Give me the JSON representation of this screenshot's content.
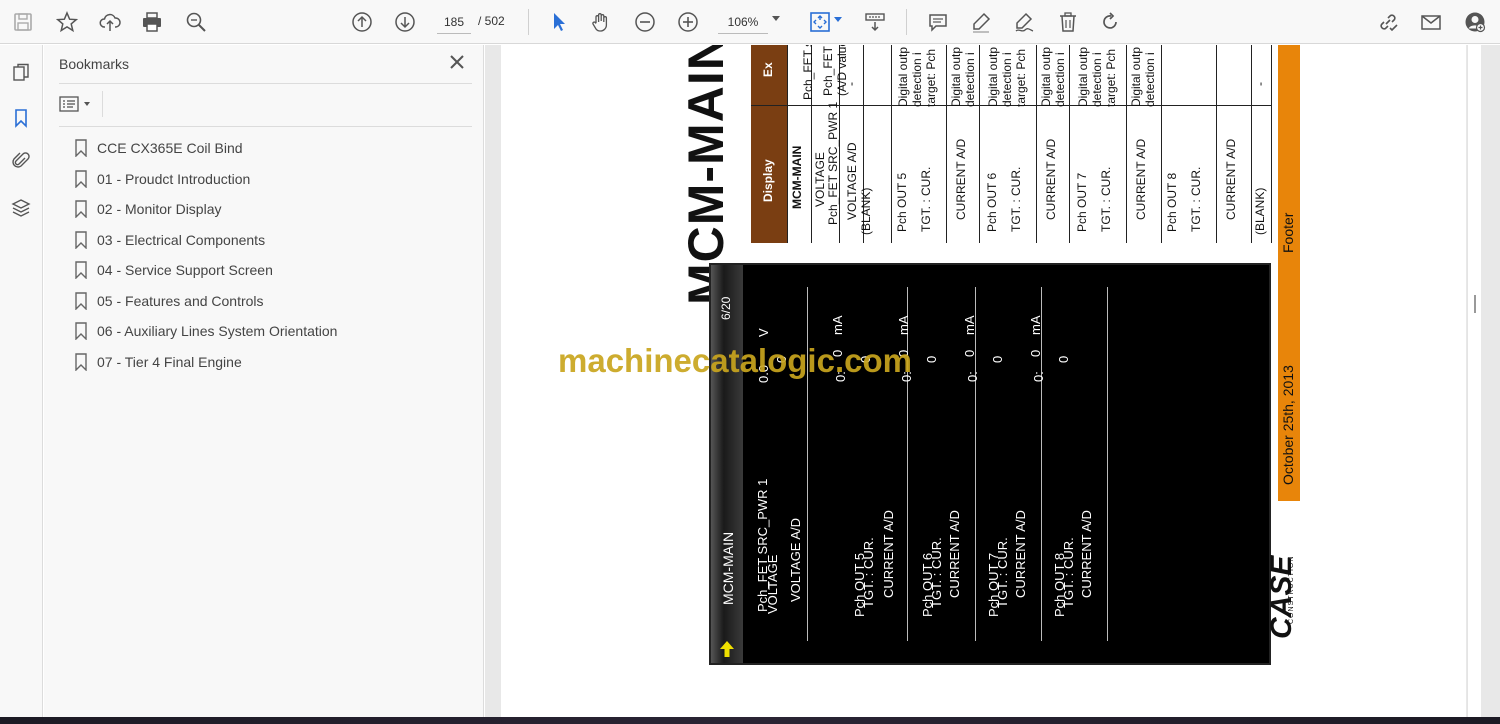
{
  "toolbar": {
    "current_page": "185",
    "page_total": "/ 502",
    "zoom": "106%"
  },
  "bookmarks": {
    "title": "Bookmarks",
    "items": [
      {
        "label": "CCE CX365E Coil Bind"
      },
      {
        "label": "01 - Proudct Introduction"
      },
      {
        "label": "02 - Monitor Display"
      },
      {
        "label": "03 - Electrical Components"
      },
      {
        "label": "04 - Service Support Screen"
      },
      {
        "label": "05 - Features and Controls"
      },
      {
        "label": "06 - Auxiliary Lines System Orientation"
      },
      {
        "label": "07 - Tier 4 Final Engine"
      }
    ]
  },
  "document": {
    "heading": "MCM-MAIN",
    "table_header": {
      "col1": "Display",
      "col2": "Ex"
    },
    "table_display_col": [
      "MCM-MAIN",
      "Pch_FET SRC_PWR 1",
      "VOLTAGE",
      "VOLTAGE A/D",
      "(BLANK)",
      "Pch OUT 5",
      "TGT. : CUR.",
      "CURRENT A/D",
      "Pch OUT 6",
      "TGT. : CUR.",
      "CURRENT A/D",
      "Pch OUT 7",
      "TGT. : CUR.",
      "CURRENT A/D",
      "Pch OUT 8",
      "TGT. : CUR.",
      "CURRENT A/D",
      "(BLANK)"
    ],
    "table_expl_col": [
      "-",
      "Pch_FET s",
      "Pch_FET s",
      "(A/D value",
      "-",
      "Digital outp",
      "detection i",
      "target: Pch",
      "Digital outp",
      "detection i",
      "Digital outp",
      "detection i",
      "target: Pch",
      "Digital outp",
      "detection i",
      "Digital outp",
      "detection i",
      "target: Pch",
      "Digital outp",
      "detection i",
      "-"
    ],
    "monitor": {
      "title": "MCM-MAIN",
      "page": "6/20",
      "rows": [
        {
          "label1": "Pch_FET SRC_PWR 1",
          "label2": "VOLTAGE",
          "value": "0.0",
          "unit": "V"
        },
        {
          "label1": "VOLTAGE A/D",
          "label2": "",
          "value": "0",
          "unit": ""
        },
        {
          "label1": "Pch OUT 5",
          "label2": "TGT. : CUR.",
          "value": "0:",
          "value2": "0",
          "unit": "mA"
        },
        {
          "label1": "CURRENT A/D",
          "label2": "",
          "value": "0",
          "unit": ""
        },
        {
          "label1": "Pch OUT 6",
          "label2": "TGT. : CUR.",
          "value": "0:",
          "value2": "0",
          "unit": "mA"
        },
        {
          "label1": "CURRENT A/D",
          "label2": "",
          "value": "0",
          "unit": ""
        },
        {
          "label1": "Pch OUT 7",
          "label2": "TGT. : CUR.",
          "value": "0:",
          "value2": "0",
          "unit": "mA"
        },
        {
          "label1": "CURRENT A/D",
          "label2": "",
          "value": "0",
          "unit": ""
        },
        {
          "label1": "Pch OUT 8",
          "label2": "TGT. : CUR.",
          "value": "0:",
          "value2": "0",
          "unit": "mA"
        },
        {
          "label1": "CURRENT A/D",
          "label2": "",
          "value": "0",
          "unit": ""
        }
      ]
    },
    "footer_word": "Footer",
    "footer_date": "October 25th, 2013",
    "logo": "CASE",
    "logo_sub": "CONSTRUCTION",
    "watermark": "machinecatalogic.com"
  },
  "colors": {
    "accent_blue": "#2a6fd6",
    "footer_orange": "#e8850a",
    "table_header_brown": "#7a3e12",
    "watermark_gold": "#c9a51e"
  },
  "icons": [
    "save-icon",
    "star-icon",
    "upload-icon",
    "print-icon",
    "zoom-search-icon",
    "page-up-icon",
    "page-down-icon",
    "cursor-icon",
    "hand-icon",
    "zoom-out-icon",
    "zoom-in-icon",
    "fit-page-icon",
    "scroll-mode-icon",
    "comment-icon",
    "highlight-icon",
    "sign-icon",
    "delete-icon",
    "rotate-icon",
    "share-link-icon",
    "mail-icon",
    "account-icon",
    "pages-icon",
    "bookmark-icon",
    "attachment-icon",
    "layers-icon"
  ]
}
